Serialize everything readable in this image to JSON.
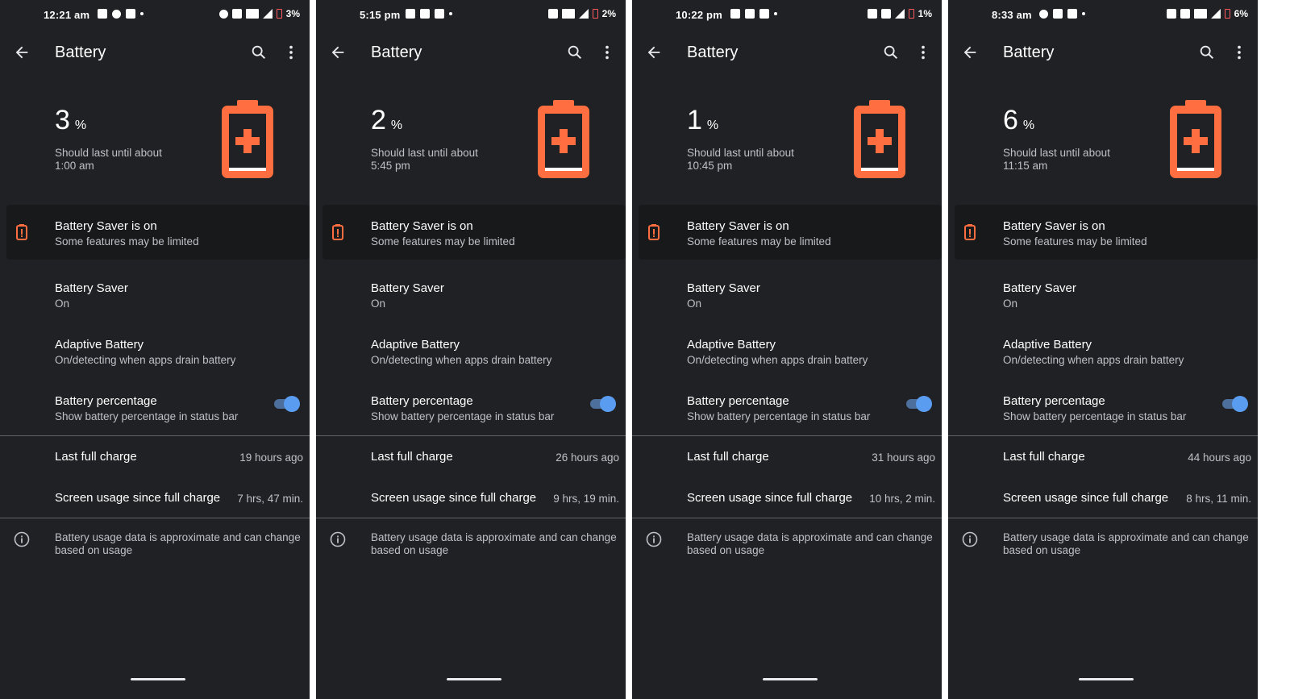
{
  "colors": {
    "background": "#202124",
    "accent_orange": "#ff6e40",
    "toggle_blue": "#5a9cf0",
    "card": "#18191b",
    "divider": "#5f6368"
  },
  "shared": {
    "title": "Battery",
    "should_last": "Should last until about",
    "percent_unit": "%",
    "saver_banner_title": "Battery Saver is on",
    "saver_banner_subtitle": "Some features may be limited",
    "battery_saver_label": "Battery Saver",
    "battery_saver_value": "On",
    "adaptive_label": "Adaptive Battery",
    "adaptive_value": "On/detecting when apps drain battery",
    "percentage_label": "Battery percentage",
    "percentage_desc": "Show battery percentage in status bar",
    "percentage_toggle_on": true,
    "last_full_charge_label": "Last full charge",
    "screen_usage_label": "Screen usage since full charge",
    "footer": "Battery usage data is approximate and can change based on usage",
    "icons": [
      "back-arrow-icon",
      "search-icon",
      "more-vert-icon",
      "battery-alert-icon",
      "battery-saver-icon",
      "info-icon"
    ]
  },
  "screens": [
    {
      "status_time": "12:21 am",
      "status_left_icons": [
        "youtube-icon",
        "headset-icon",
        "gmail-icon",
        "dot-icon"
      ],
      "status_right_icons": [
        "headset-icon",
        "vibrate-icon",
        "volte-icon",
        "signal-icon"
      ],
      "status_battery": "3%",
      "level": "3",
      "until": "1:00 am",
      "last_full_charge": "19 hours ago",
      "screen_usage": "7 hrs, 47 min."
    },
    {
      "status_time": "5:15 pm",
      "status_left_icons": [
        "telegram-icon",
        "touch-icon",
        "youtube-icon",
        "dot-icon"
      ],
      "status_right_icons": [
        "vibrate-icon",
        "volte-icon",
        "signal-icon"
      ],
      "status_battery": "2%",
      "level": "2",
      "until": "5:45 pm",
      "last_full_charge": "26 hours ago",
      "screen_usage": "9 hrs, 19 min."
    },
    {
      "status_time": "10:22 pm",
      "status_left_icons": [
        "facebook-icon",
        "facebook-icon",
        "youtube-icon",
        "dot-icon"
      ],
      "status_right_icons": [
        "vibrate-icon",
        "wifi-icon",
        "signal-icon"
      ],
      "status_battery": "1%",
      "level": "1",
      "until": "10:45 pm",
      "last_full_charge": "31 hours ago",
      "screen_usage": "10 hrs, 2 min."
    },
    {
      "status_time": "8:33 am",
      "status_left_icons": [
        "messenger-icon",
        "youtube-icon",
        "gmail-icon",
        "dot-icon"
      ],
      "status_right_icons": [
        "vibrate-icon",
        "wifi-icon",
        "volte-icon",
        "signal-icon"
      ],
      "status_battery": "6%",
      "level": "6",
      "until": "11:15 am",
      "last_full_charge": "44 hours ago",
      "screen_usage": "8 hrs, 11 min."
    }
  ]
}
